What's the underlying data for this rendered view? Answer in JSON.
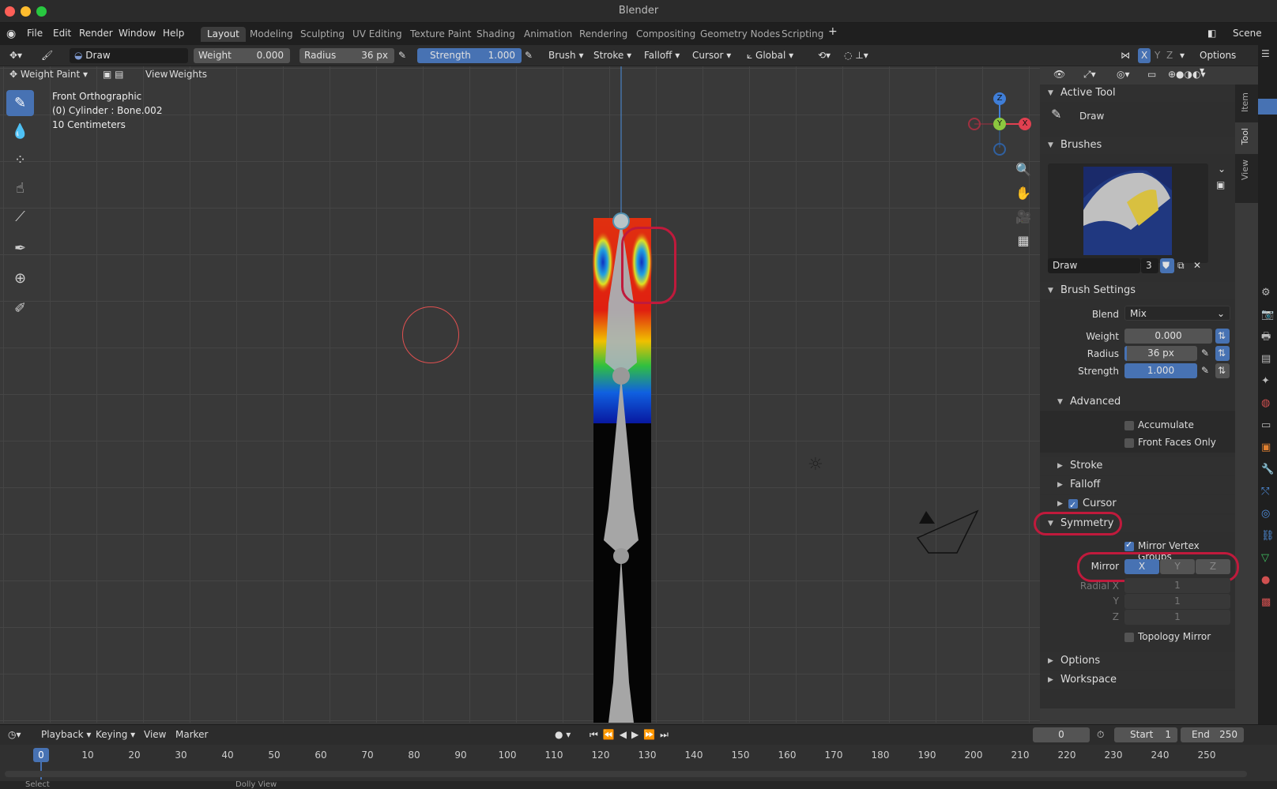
{
  "window": {
    "title": "Blender"
  },
  "menu": [
    "File",
    "Edit",
    "Render",
    "Window",
    "Help"
  ],
  "workspaces": [
    "Layout",
    "Modeling",
    "Sculpting",
    "UV Editing",
    "Texture Paint",
    "Shading",
    "Animation",
    "Rendering",
    "Compositing",
    "Geometry Nodes",
    "Scripting"
  ],
  "scene": "Scene",
  "toolbar": {
    "brush_name": "Draw",
    "weight_label": "Weight",
    "weight_value": "0.000",
    "radius_label": "Radius",
    "radius_value": "36 px",
    "strength_label": "Strength",
    "strength_value": "1.000",
    "menus": [
      "Brush",
      "Stroke",
      "Falloff",
      "Cursor"
    ],
    "orientation": "Global",
    "options": "Options",
    "axes": [
      "X",
      "Y",
      "Z"
    ]
  },
  "header": {
    "mode": "Weight Paint",
    "menus": [
      "View",
      "Weights"
    ]
  },
  "viewport": {
    "view_name": "Front Orthographic",
    "object_info": "(0) Cylinder : Bone.002",
    "scale": "10 Centimeters"
  },
  "gizmo": {
    "z": "Z",
    "y": "Y",
    "x": "X"
  },
  "npanel": {
    "tabs": [
      "Item",
      "Tool",
      "View"
    ],
    "active_tool": {
      "title": "Active Tool",
      "tool": "Draw"
    },
    "brushes": {
      "title": "Brushes",
      "name": "Draw",
      "users": "3"
    },
    "brush_settings": {
      "title": "Brush Settings",
      "blend_label": "Blend",
      "blend_value": "Mix",
      "weight_label": "Weight",
      "weight_value": "0.000",
      "radius_label": "Radius",
      "radius_value": "36 px",
      "strength_label": "Strength",
      "strength_value": "1.000"
    },
    "advanced": {
      "title": "Advanced",
      "accumulate": "Accumulate",
      "front_faces": "Front Faces Only"
    },
    "collapsed": [
      "Stroke",
      "Falloff",
      "Cursor"
    ],
    "symmetry": {
      "title": "Symmetry",
      "mirror_vg": "Mirror Vertex Groups",
      "mirror_label": "Mirror",
      "axes": [
        "X",
        "Y",
        "Z"
      ],
      "radial_x_label": "Radial X",
      "radial_y_label": "Y",
      "radial_z_label": "Z",
      "radial_x": "1",
      "radial_y": "1",
      "radial_z": "1",
      "topology": "Topology Mirror"
    },
    "options": "Options",
    "workspace": "Workspace"
  },
  "timeline": {
    "menus": [
      "Playback",
      "Keying",
      "View",
      "Marker"
    ],
    "current_frame": "0",
    "start_label": "Start",
    "start": "1",
    "end_label": "End",
    "end": "250",
    "ticks": [
      "0",
      "10",
      "20",
      "30",
      "40",
      "50",
      "60",
      "70",
      "80",
      "90",
      "100",
      "110",
      "120",
      "130",
      "140",
      "150",
      "160",
      "170",
      "180",
      "190",
      "200",
      "210",
      "220",
      "230",
      "240",
      "250"
    ]
  },
  "status": {
    "left": "Select",
    "mid": "Dolly View"
  }
}
